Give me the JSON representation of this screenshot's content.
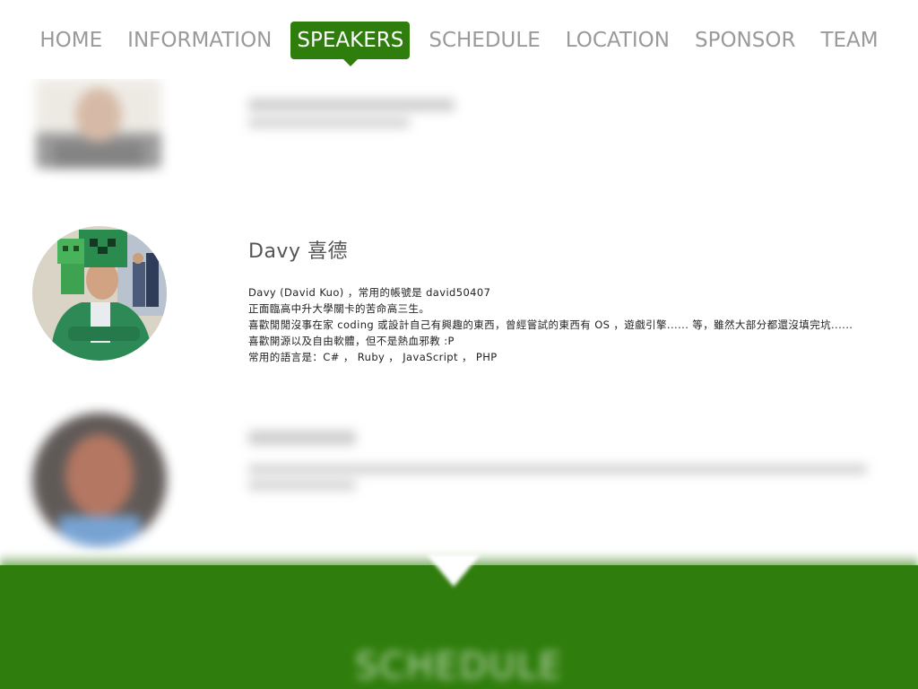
{
  "nav": {
    "items": [
      {
        "label": "HOME",
        "active": false
      },
      {
        "label": "INFORMATION",
        "active": false
      },
      {
        "label": "SPEAKERS",
        "active": true
      },
      {
        "label": "SCHEDULE",
        "active": false
      },
      {
        "label": "LOCATION",
        "active": false
      },
      {
        "label": "SPONSOR",
        "active": false
      },
      {
        "label": "TEAM",
        "active": false
      }
    ]
  },
  "speakers": [
    {
      "name": "Davy 喜德",
      "bio": [
        "Davy (David Kuo) ，常用的帳號是 david50407",
        "正面臨高中升大學關卡的苦命高三生。",
        "喜歡閒閒沒事在家 coding 或設計自己有興趣的東西，曾經嘗試的東西有 OS ，遊戲引擎...... 等，雖然大部分都還沒填完坑......",
        "喜歡開源以及自由軟體，但不是熱血邪教 :P",
        "常用的語言是：C# ， Ruby ， JavaScript ， PHP"
      ]
    }
  ],
  "footer": {
    "section_title": "SCHEDULE"
  },
  "colors": {
    "accent": "#2f7d0c",
    "nav_text": "#9a9a9a"
  }
}
